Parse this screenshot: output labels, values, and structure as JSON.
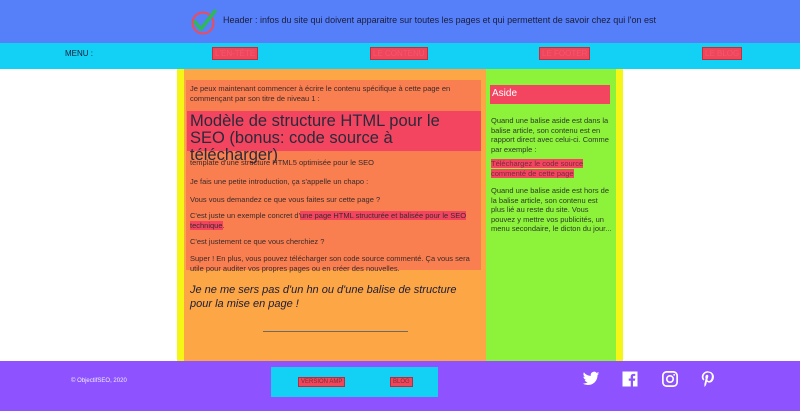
{
  "header": {
    "logo": "checkmark-logo-icon",
    "text": "Header : infos du site qui doivent apparaitre sur toutes les pages et qui permettent de savoir chez qui l'on est"
  },
  "nav": {
    "menu_label": "MENU :",
    "links": [
      "L'EN-TÊTE",
      "LE CONTENU",
      "LE FOOTER",
      "LE BLOG"
    ]
  },
  "article": {
    "intro": "Je peux maintenant commencer à écrire le contenu spécifique à cette page en commençant par son titre de niveau 1 :",
    "h1": "Modèle de structure HTML pour le SEO (bonus: code source à télécharger)",
    "p1": "template d'une structure HTML5 optimisée pour le SEO",
    "p2": "Je fais une petite introduction, ça s'appelle un chapo :",
    "p3": "Vous vous demandez ce que vous faites sur cette page ?",
    "p4_before": "C'est juste un exemple concret d'",
    "p4_link": "une page HTML structurée et balisée pour le SEO technique",
    "p4_after": ".",
    "p5": "C'est justement ce que vous cherchiez ?",
    "p6": "Super ! En plus, vous pouvez télécharger son code source commenté. Ça vous sera utile pour auditer vos propres pages ou en créer des nouvelles.",
    "subheading": "Je ne me sers pas d'un hn ou d'une balise de structure pour la mise en page !"
  },
  "aside": {
    "title": "Aside",
    "p1": "Quand une balise aside est dans la balise article, son contenu est en rapport direct avec celui-ci. Comme par exemple :",
    "link": "Téléchargez le code source commenté de cette page",
    "p2": "Quand une balise aside est hors de la balise article, son contenu est plus lié au reste du site. Vous pouvez y mettre vos publicités, un menu secondaire, le dicton du jour..."
  },
  "footer": {
    "copyright": "© ObjectifSEO, 2020",
    "links": [
      "VERSION AMP",
      "BLOG"
    ],
    "social": [
      "twitter-icon",
      "facebook-icon",
      "instagram-icon",
      "pinterest-icon"
    ]
  },
  "colors": {
    "header_bg": "#5580f9",
    "nav_bg": "#12d1f5",
    "article_bg": "#fca645",
    "article_inner_bg": "#f97f50",
    "highlight": "#f44560",
    "aside_bg": "#8df23a",
    "side_bars": "#f5f516",
    "footer_bg": "#8f52ff"
  }
}
